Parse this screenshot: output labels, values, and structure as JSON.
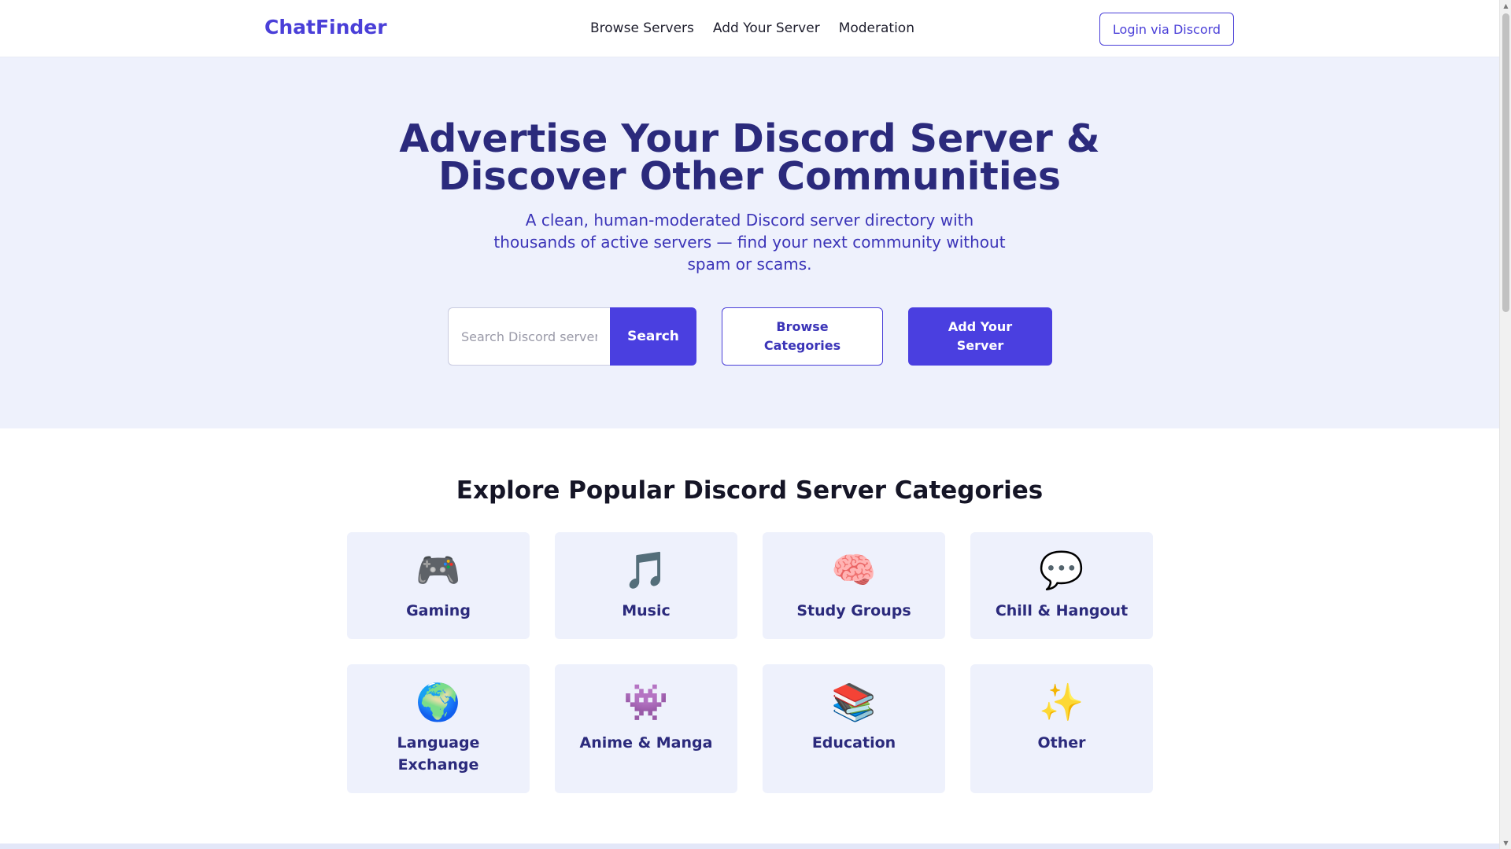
{
  "header": {
    "brand": "ChatFinder",
    "nav": [
      "Browse Servers",
      "Add Your Server",
      "Moderation"
    ],
    "login_label": "Login via Discord"
  },
  "hero": {
    "title_line1": "Advertise Your Discord Server &",
    "title_line2": "Discover Other Communities",
    "subtitle": "A clean, human-moderated Discord server directory with thousands of active servers — find your next community without spam or scams.",
    "search_placeholder": "Search Discord servers...",
    "search_label": "Search",
    "browse_label": "Browse Categories",
    "add_label": "Add Your Server"
  },
  "categories": {
    "title": "Explore Popular Discord Server Categories",
    "items": [
      {
        "icon": "🎮",
        "icon_name": "game-controller-icon",
        "label": "Gaming"
      },
      {
        "icon": "🎵",
        "icon_name": "music-note-icon",
        "label": "Music"
      },
      {
        "icon": "🧠",
        "icon_name": "brain-icon",
        "label": "Study Groups"
      },
      {
        "icon": "💬",
        "icon_name": "speech-bubble-icon",
        "label": "Chill & Hangout"
      },
      {
        "icon": "🌍",
        "icon_name": "globe-icon",
        "label": "Language Exchange"
      },
      {
        "icon": "👾",
        "icon_name": "alien-monster-icon",
        "label": "Anime & Manga"
      },
      {
        "icon": "📚",
        "icon_name": "books-icon",
        "label": "Education"
      },
      {
        "icon": "✨",
        "icon_name": "sparkles-icon",
        "label": "Other"
      }
    ]
  },
  "colors": {
    "accent": "#4a3fe0",
    "hero_bg": "#eef1fc",
    "heading": "#2b2a7c"
  }
}
